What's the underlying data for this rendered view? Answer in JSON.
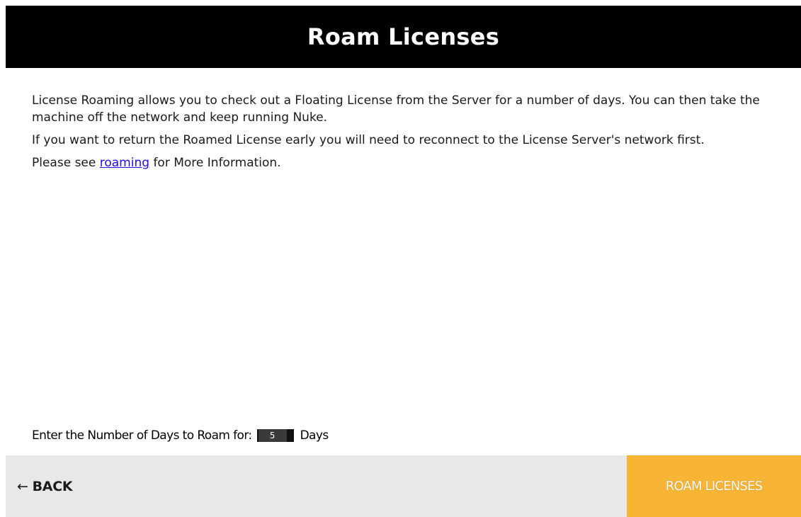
{
  "header": {
    "title": "Roam Licenses"
  },
  "content": {
    "paragraph1": "License Roaming allows you to check out a Floating License from the Server for a number of days. You can then take the machine off the network and keep running Nuke.",
    "paragraph2": "If you want to return the Roamed License early you will need to reconnect to the License Server's network first.",
    "paragraph3_prefix": "Please see ",
    "paragraph3_link": "roaming",
    "paragraph3_suffix": " for More Information."
  },
  "days": {
    "label": "Enter the Number of Days to Roam for:",
    "value": "5",
    "unit": "Days"
  },
  "footer": {
    "back_arrow": "←",
    "back_label": "BACK",
    "roam_label": "ROAM LICENSES"
  },
  "colors": {
    "header_bg": "#000000",
    "footer_bg": "#e8e8e8",
    "accent": "#f8b434",
    "link": "#1a0dee"
  }
}
